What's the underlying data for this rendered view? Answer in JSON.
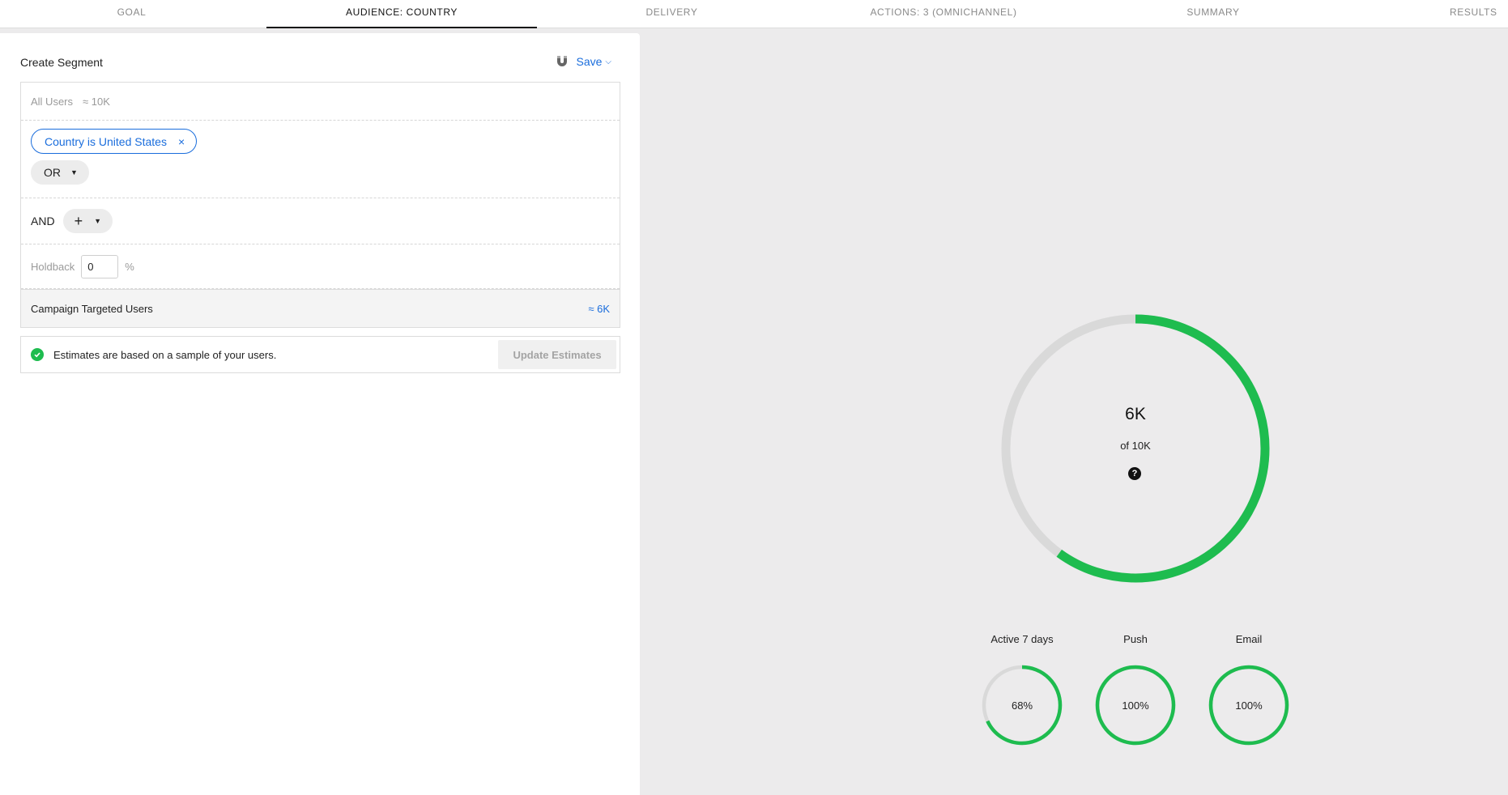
{
  "tabs": [
    {
      "label": "GOAL",
      "active": false
    },
    {
      "label": "AUDIENCE: COUNTRY",
      "active": true
    },
    {
      "label": "DELIVERY",
      "active": false
    },
    {
      "label": "ACTIONS: 3 (OMNICHANNEL)",
      "active": false
    },
    {
      "label": "SUMMARY",
      "active": false
    },
    {
      "label": "RESULTS",
      "active": false
    }
  ],
  "segment": {
    "title": "Create Segment",
    "save_label": "Save",
    "all_users_label": "All Users",
    "all_users_count": "≈ 10K",
    "filter_chip": "Country is United States",
    "filter_remove": "×",
    "or_label": "OR",
    "and_label": "AND",
    "plus_label": "+",
    "holdback_label": "Holdback",
    "holdback_value": "0",
    "holdback_unit": "%",
    "targeted_label": "Campaign Targeted Users",
    "targeted_value": "≈ 6K"
  },
  "estimates": {
    "note": "Estimates are based on a sample of your users.",
    "update_label": "Update Estimates"
  },
  "reach": {
    "value_label": "6K",
    "of_label": "of 10K",
    "fraction": 0.6,
    "help_glyph": "?"
  },
  "breakdown": [
    {
      "label": "Active 7 days",
      "value_label": "68%",
      "fraction": 0.68
    },
    {
      "label": "Push",
      "value_label": "100%",
      "fraction": 1.0
    },
    {
      "label": "Email",
      "value_label": "100%",
      "fraction": 1.0
    }
  ],
  "colors": {
    "accent": "#1a6ddc",
    "ring_fill": "#1ebc4f",
    "ring_track": "#d9d9d9"
  }
}
